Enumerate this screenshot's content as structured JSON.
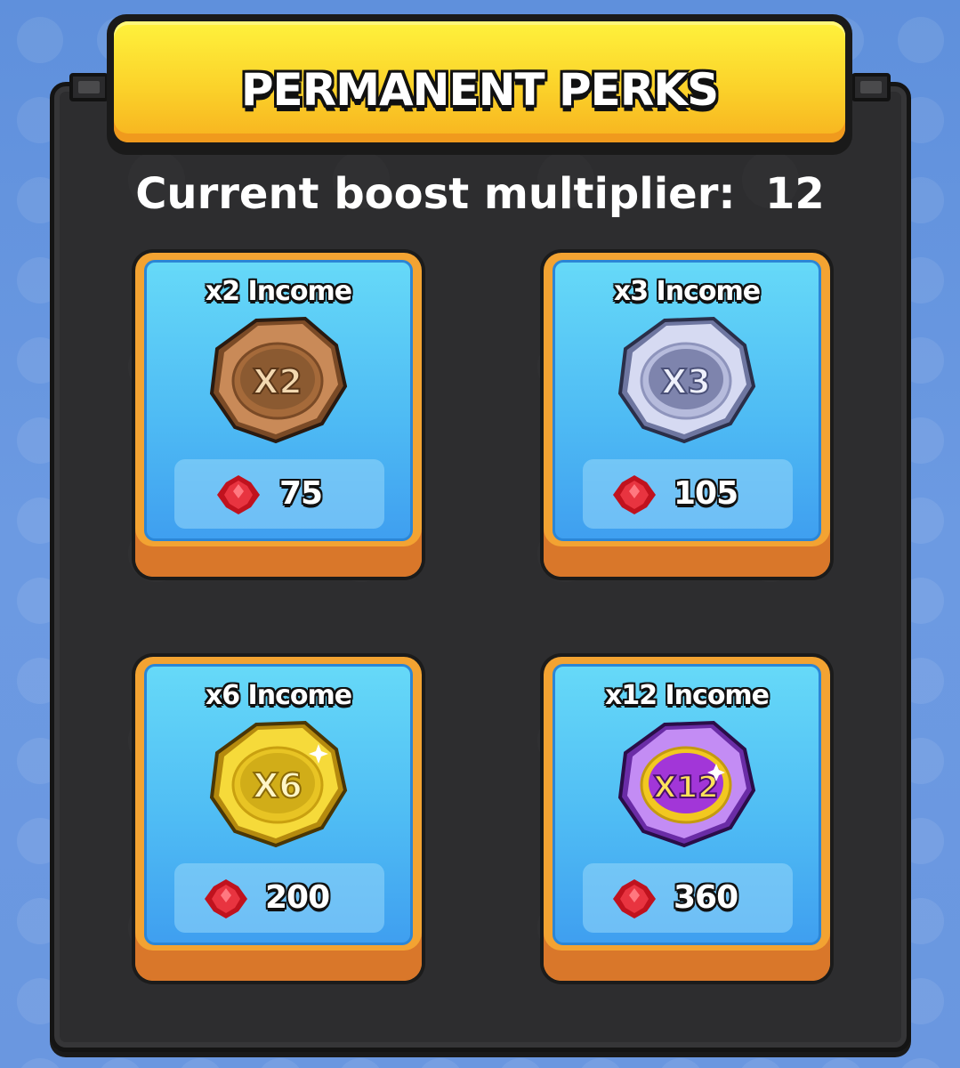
{
  "title": "PERMANENT PERKS",
  "multiplier": {
    "label": "Current boost multiplier:",
    "value": "12"
  },
  "perks": [
    {
      "title": "x2 Income",
      "badge": "X2",
      "price": "75",
      "icon": "bronze-x2-medal-icon"
    },
    {
      "title": "x3 Income",
      "badge": "X3",
      "price": "105",
      "icon": "silver-x3-medal-icon"
    },
    {
      "title": "x6 Income",
      "badge": "X6",
      "price": "200",
      "icon": "gold-x6-medal-icon"
    },
    {
      "title": "x12 Income",
      "badge": "X12",
      "price": "360",
      "icon": "purple-x12-medal-icon"
    }
  ],
  "currency_icon": "red-gem-icon",
  "colors": {
    "banner": "#fbd22a",
    "board": "#2d2d2f",
    "card_frame": "#f3a332",
    "card_face": "#4fbcf4",
    "gem": "#e0202e"
  }
}
